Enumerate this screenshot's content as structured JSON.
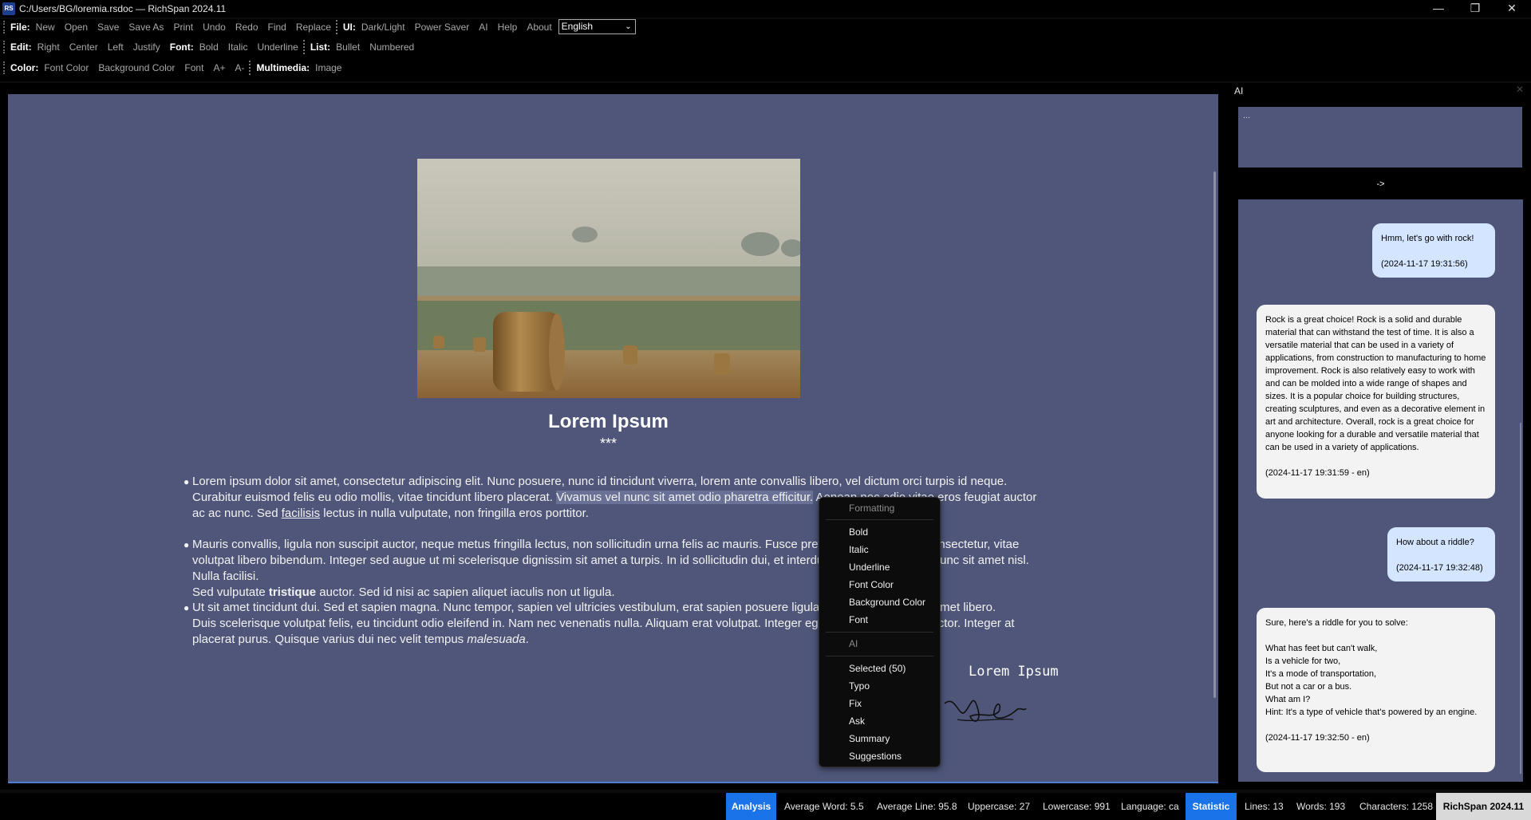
{
  "window": {
    "app_icon": "RS",
    "title": "C:/Users/BG/loremia.rsdoc — RichSpan 2024.11",
    "minimize": "—",
    "maximize": "❐",
    "close": "✕"
  },
  "toolbar1": {
    "file_label": "File:",
    "file_items": [
      "New",
      "Open",
      "Save",
      "Save As",
      "Print",
      "Undo",
      "Redo",
      "Find",
      "Replace"
    ],
    "ui_label": "UI:",
    "ui_items": [
      "Dark/Light",
      "Power Saver",
      "AI",
      "Help",
      "About"
    ],
    "language": "English"
  },
  "toolbar2": {
    "edit_label": "Edit:",
    "edit_items": [
      "Right",
      "Center",
      "Left",
      "Justify"
    ],
    "font_label": "Font:",
    "font_items": [
      "Bold",
      "Italic",
      "Underline"
    ],
    "list_label": "List:",
    "list_items": [
      "Bullet",
      "Numbered"
    ]
  },
  "toolbar3": {
    "color_label": "Color:",
    "color_items": [
      "Font Color",
      "Background Color",
      "Font",
      "A+",
      "A-"
    ],
    "multimedia_label": "Multimedia:",
    "multimedia_items": [
      "Image"
    ]
  },
  "document": {
    "title": "Lorem Ipsum",
    "stars": "***",
    "para1": {
      "a": "Lorem ipsum dolor sit amet, consectetur adipiscing elit. Nunc posuere, nunc id tincidunt viverra, lorem ante convallis libero, vel dictum orci turpis id neque.",
      "b1": "Curabitur euismod felis eu odio mollis, vitae tincidunt libero placerat. ",
      "b_sel": "Vivamus vel nunc sit amet odio pharetra efficitur.",
      "b2": " Aenean nec odio vitae eros feugiat auctor",
      "c1": "ac ac nunc. Sed ",
      "c_u": "facilisis",
      "c2": " lectus in nulla vulputate, non fringilla eros porttitor."
    },
    "para2": {
      "a": "Mauris convallis, ligula non suscipit auctor, neque metus fringilla lectus, non sollicitudin urna felis ac mauris. Fusce pretium, lorem sit amet consectetur, vitae",
      "b": "volutpat libero bibendum. Integer sed augue ut mi scelerisque dignissim sit amet a turpis. In id sollicitudin dui, et interdum nisl. Nulla facilisi. Nunc sit amet nisl. Nulla facilisi.",
      "c1": "Sed vulputate ",
      "c_b": "tristique",
      "c2": " auctor. Sed id nisi ac sapien aliquet iaculis non ut ligula."
    },
    "para3": {
      "a": "Ut sit amet tincidunt dui. Sed et sapien magna. Nunc tempor, sapien vel ultricies vestibulum, erat sapien posuere ligula, ac tempus lorem sit amet libero.",
      "b": "Duis scelerisque volutpat felis, eu tincidunt odio eleifend in. Nam nec venenatis nulla. Aliquam erat volutpat. Integer egestas, mi at lobortis auctor. Integer at",
      "c1": "placerat purus. Quisque varius dui nec velit tempus ",
      "c_i": "malesuada",
      "c2": "."
    },
    "signature_text": "Lorem Ipsum"
  },
  "context_menu": {
    "formatting_header": "Formatting",
    "formatting_items": [
      "Bold",
      "Italic",
      "Underline",
      "Font Color",
      "Background Color",
      "Font"
    ],
    "ai_header": "AI",
    "ai_items": [
      "Selected (50)",
      "Typo",
      "Fix",
      "Ask",
      "Summary",
      "Suggestions"
    ]
  },
  "ai_panel": {
    "title": "AI",
    "close": "✕",
    "input_text": "...",
    "send_label": "->",
    "messages": [
      {
        "role": "user",
        "text": "Hmm, let's go with rock!",
        "time": "(2024-11-17 19:31:56)"
      },
      {
        "role": "ai",
        "text": "Rock is a great choice! Rock is a solid and durable material that can withstand the test of time. It is also a versatile material that can be used in a variety of applications, from construction to manufacturing to home improvement. Rock is also relatively easy to work with and can be molded into a wide range of shapes and sizes. It is a popular choice for building structures, creating sculptures, and even as a decorative element in art and architecture. Overall, rock is a great choice for anyone looking for a durable and versatile material that can be used in a variety of applications.",
        "time": "(2024-11-17 19:31:59 - en)"
      },
      {
        "role": "user",
        "text": "How about a riddle?",
        "time": "(2024-11-17 19:32:48)"
      },
      {
        "role": "ai",
        "text": "Sure, here's a riddle for you to solve:\n\nWhat has feet but can't walk,\nIs a vehicle for two,\nIt's a mode of transportation,\nBut not a car or a bus.\nWhat am I?\nHint: It's a type of vehicle that's powered by an engine.",
        "time": "(2024-11-17 19:32:50 - en)"
      }
    ]
  },
  "statusbar": {
    "analysis": "Analysis",
    "avg_word": "Average Word: 5.5",
    "avg_line": "Average Line: 95.8",
    "uppercase": "Uppercase: 27",
    "lowercase": "Lowercase: 991",
    "language": "Language: ca",
    "statistic": "Statistic",
    "lines": "Lines: 13",
    "words": "Words: 193",
    "characters": "Characters: 1258",
    "brand": "RichSpan 2024.11"
  },
  "colors": {
    "editor_bg": "#4f5679",
    "accent": "#1a73e8",
    "user_bubble": "#d4e6ff",
    "ai_bubble": "#f3f3f3"
  }
}
